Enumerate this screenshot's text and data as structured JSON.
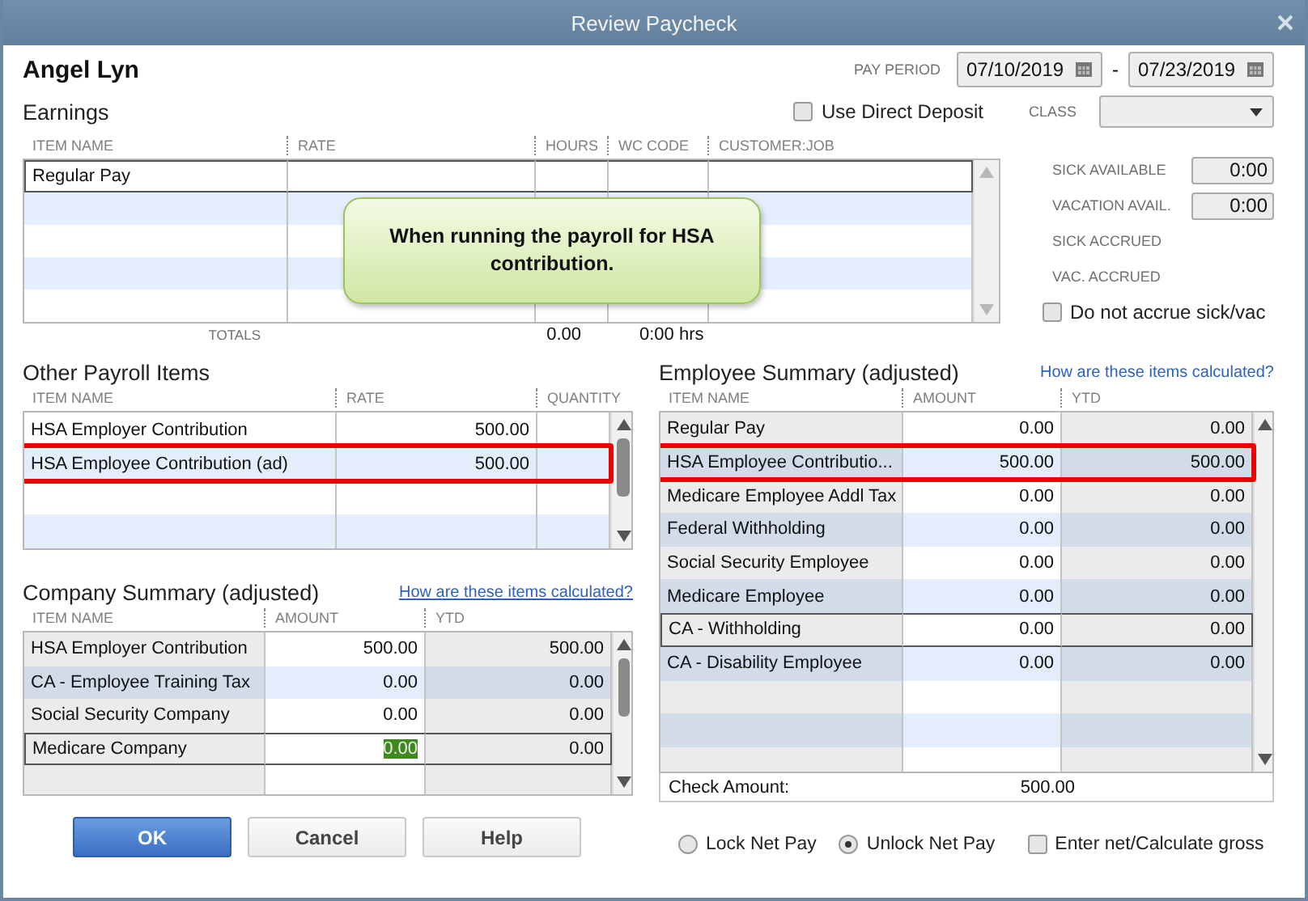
{
  "window": {
    "title": "Review Paycheck"
  },
  "employee": "Angel Lyn",
  "pay_period": {
    "label": "PAY PERIOD",
    "start": "07/10/2019",
    "separator": "-",
    "end": "07/23/2019"
  },
  "direct_deposit": {
    "label": "Use Direct Deposit",
    "checked": false
  },
  "class_field": {
    "label": "CLASS"
  },
  "earnings": {
    "title": "Earnings",
    "columns": [
      "ITEM NAME",
      "RATE",
      "HOURS",
      "WC CODE",
      "CUSTOMER:JOB"
    ],
    "rows": [
      {
        "item_name": "Regular Pay",
        "current": true
      }
    ],
    "totals": {
      "label": "TOTALS",
      "hours": "0.00",
      "time": "0:00 hrs"
    }
  },
  "accruals": [
    {
      "label": "SICK AVAILABLE",
      "value": "0:00"
    },
    {
      "label": "VACATION AVAIL.",
      "value": "0:00"
    },
    {
      "label": "SICK ACCRUED"
    },
    {
      "label": "VAC. ACCRUED"
    }
  ],
  "no_accrue": {
    "label": "Do not accrue sick/vac",
    "checked": false
  },
  "callout": {
    "text": "When running the payroll for HSA contribution."
  },
  "other_payroll_items": {
    "title": "Other Payroll Items",
    "columns": [
      "ITEM NAME",
      "RATE",
      "QUANTITY"
    ],
    "rows": [
      {
        "item_name": "HSA Employer Contribution",
        "rate": "500.00",
        "highlighted": false
      },
      {
        "item_name": "HSA Employee Contribution (ad)",
        "rate": "500.00",
        "highlighted": true
      }
    ]
  },
  "company_summary": {
    "title": "Company Summary  (adjusted)",
    "link": "How are these items calculated?",
    "columns": [
      "ITEM NAME",
      "AMOUNT",
      "YTD"
    ],
    "rows": [
      {
        "item_name": "HSA Employer Contribution",
        "amount": "500.00",
        "ytd": "500.00",
        "current": false,
        "amount_selected": false
      },
      {
        "item_name": "CA - Employee Training Tax",
        "amount": "0.00",
        "ytd": "0.00",
        "current": false,
        "amount_selected": false
      },
      {
        "item_name": "Social Security Company",
        "amount": "0.00",
        "ytd": "0.00",
        "current": false,
        "amount_selected": false
      },
      {
        "item_name": "Medicare Company",
        "amount": "0.00",
        "ytd": "0.00",
        "current": true,
        "amount_selected": true
      }
    ]
  },
  "employee_summary": {
    "title": "Employee Summary (adjusted)",
    "link": "How are these items calculated?",
    "columns": [
      "ITEM NAME",
      "AMOUNT",
      "YTD"
    ],
    "rows": [
      {
        "item_name": "Regular Pay",
        "amount": "0.00",
        "ytd": "0.00",
        "highlighted": false,
        "current": false
      },
      {
        "item_name": "HSA Employee Contributio...",
        "amount": "500.00",
        "ytd": "500.00",
        "highlighted": true,
        "current": false
      },
      {
        "item_name": "Medicare Employee Addl Tax",
        "amount": "0.00",
        "ytd": "0.00",
        "highlighted": false,
        "current": false
      },
      {
        "item_name": "Federal Withholding",
        "amount": "0.00",
        "ytd": "0.00",
        "highlighted": false,
        "current": false
      },
      {
        "item_name": "Social Security Employee",
        "amount": "0.00",
        "ytd": "0.00",
        "highlighted": false,
        "current": false
      },
      {
        "item_name": "Medicare Employee",
        "amount": "0.00",
        "ytd": "0.00",
        "highlighted": false,
        "current": false
      },
      {
        "item_name": "CA - Withholding",
        "amount": "0.00",
        "ytd": "0.00",
        "highlighted": false,
        "current": true
      },
      {
        "item_name": "CA - Disability Employee",
        "amount": "0.00",
        "ytd": "0.00",
        "highlighted": false,
        "current": false
      }
    ],
    "check_amount": {
      "label": "Check Amount:",
      "value": "500.00"
    }
  },
  "buttons": [
    {
      "label": "OK",
      "kind": "primary"
    },
    {
      "label": "Cancel",
      "kind": "normal"
    },
    {
      "label": "Help",
      "kind": "normal"
    }
  ],
  "net_pay_options": [
    {
      "label": "Lock Net Pay",
      "selected": false
    },
    {
      "label": "Unlock Net Pay",
      "selected": true
    }
  ],
  "enter_net": {
    "label": "Enter net/Calculate gross",
    "checked": false
  }
}
